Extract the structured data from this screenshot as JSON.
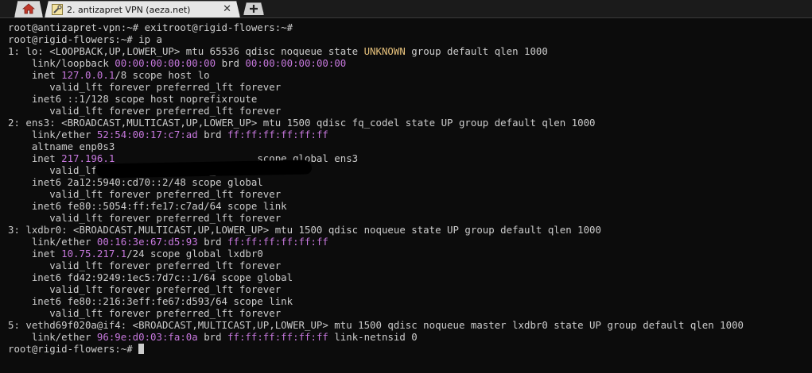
{
  "tabbar": {
    "tab_title": "2. antizapret VPN (aeza.net)",
    "close_glyph": "✕",
    "new_tab_glyph": "+"
  },
  "icons": {
    "home": "home-icon",
    "tab": "tools-icon",
    "new_tab": "plus-icon"
  },
  "colors": {
    "foreground": "#cccccc",
    "address": "#c678dd",
    "state_unknown": "#e5c07b",
    "background": "#0c0c0c"
  },
  "terminal": {
    "l1": "root@antizapret-vpn:~# exitroot@rigid-flowers:~#",
    "l2": "root@rigid-flowers:~# ip a",
    "l3a": "1: lo: <LOOPBACK,UP,LOWER_UP> mtu 65536 qdisc noqueue state ",
    "l3b": "UNKNOWN",
    "l3c": " group default qlen 1000",
    "l4a": "    link/loopback ",
    "l4b": "00:00:00:00:00:00",
    "l4c": " brd ",
    "l4d": "00:00:00:00:00:00",
    "l5a": "    inet ",
    "l5b": "127.0.0.1",
    "l5c": "/8 scope host lo",
    "l6": "       valid_lft forever preferred_lft forever",
    "l7": "    inet6 ::1/128 scope host noprefixroute",
    "l8": "       valid_lft forever preferred_lft forever",
    "l9": "2: ens3: <BROADCAST,MULTICAST,UP,LOWER_UP> mtu 1500 qdisc fq_codel state UP group default qlen 1000",
    "l10a": "    link/ether ",
    "l10b": "52:54:00:17:c7:ad",
    "l10c": " brd ",
    "l10d": "ff:ff:ff:ff:ff:ff",
    "l11": "    altname enp0s3",
    "l12a": "    inet ",
    "l12b": "217.196.1",
    "l12c": "                        scope global ens3",
    "l13": "       valid_lft forever preferred_lft forever",
    "l14": "    inet6 2a12:5940:cd70::2/48 scope global",
    "l15": "       valid_lft forever preferred_lft forever",
    "l16": "    inet6 fe80::5054:ff:fe17:c7ad/64 scope link",
    "l17": "       valid_lft forever preferred_lft forever",
    "l18": "3: lxdbr0: <BROADCAST,MULTICAST,UP,LOWER_UP> mtu 1500 qdisc noqueue state UP group default qlen 1000",
    "l19a": "    link/ether ",
    "l19b": "00:16:3e:67:d5:93",
    "l19c": " brd ",
    "l19d": "ff:ff:ff:ff:ff:ff",
    "l20a": "    inet ",
    "l20b": "10.75.217.1",
    "l20c": "/24 scope global lxdbr0",
    "l21": "       valid_lft forever preferred_lft forever",
    "l22": "    inet6 fd42:9249:1ec5:7d7c::1/64 scope global",
    "l23": "       valid_lft forever preferred_lft forever",
    "l24": "    inet6 fe80::216:3eff:fe67:d593/64 scope link",
    "l25": "       valid_lft forever preferred_lft forever",
    "l26": "5: vethd69f020a@if4: <BROADCAST,MULTICAST,UP,LOWER_UP> mtu 1500 qdisc noqueue master lxdbr0 state UP group default qlen 1000",
    "l27a": "    link/ether ",
    "l27b": "96:9e:d0:03:fa:0a",
    "l27c": " brd ",
    "l27d": "ff:ff:ff:ff:ff:ff",
    "l27e": " link-netnsid 0",
    "l28": "root@rigid-flowers:~# "
  }
}
